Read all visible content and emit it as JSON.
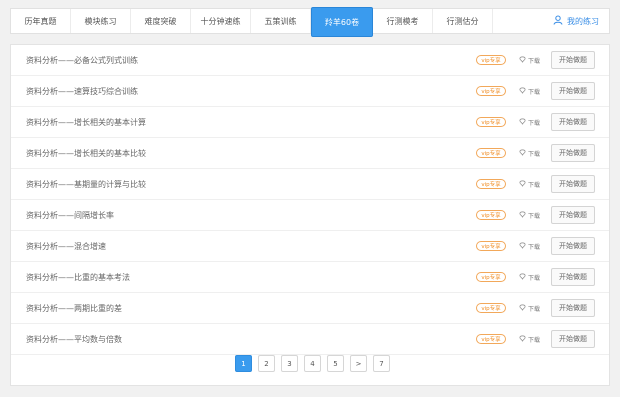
{
  "tabs": [
    {
      "label": "历年真题",
      "active": false
    },
    {
      "label": "模块练习",
      "active": false
    },
    {
      "label": "难度突破",
      "active": false
    },
    {
      "label": "十分钟速练",
      "active": false
    },
    {
      "label": "五策训练",
      "active": false
    },
    {
      "label": "羚羊60卷",
      "active": true
    },
    {
      "label": "行测模考",
      "active": false
    },
    {
      "label": "行测估分",
      "active": false
    }
  ],
  "my_practice": {
    "label": "我的练习",
    "icon": "user-icon"
  },
  "list": {
    "vip_badge": "vip专享",
    "download_label": "下载",
    "start_label": "开始做题",
    "items": [
      "资料分析——必备公式列式训练",
      "资料分析——速算技巧综合训练",
      "资料分析——增长相关的基本计算",
      "资料分析——增长相关的基本比较",
      "资料分析——基期量的计算与比较",
      "资料分析——间隔增长率",
      "资料分析——混合增速",
      "资料分析——比重的基本考法",
      "资料分析——两期比重的差",
      "资料分析——平均数与倍数"
    ]
  },
  "pagination": {
    "pages": [
      "1",
      "2",
      "3",
      "4",
      "5",
      ">",
      "7"
    ],
    "current": "1"
  },
  "colors": {
    "accent": "#3a9bee",
    "vip": "#f08a1f"
  }
}
